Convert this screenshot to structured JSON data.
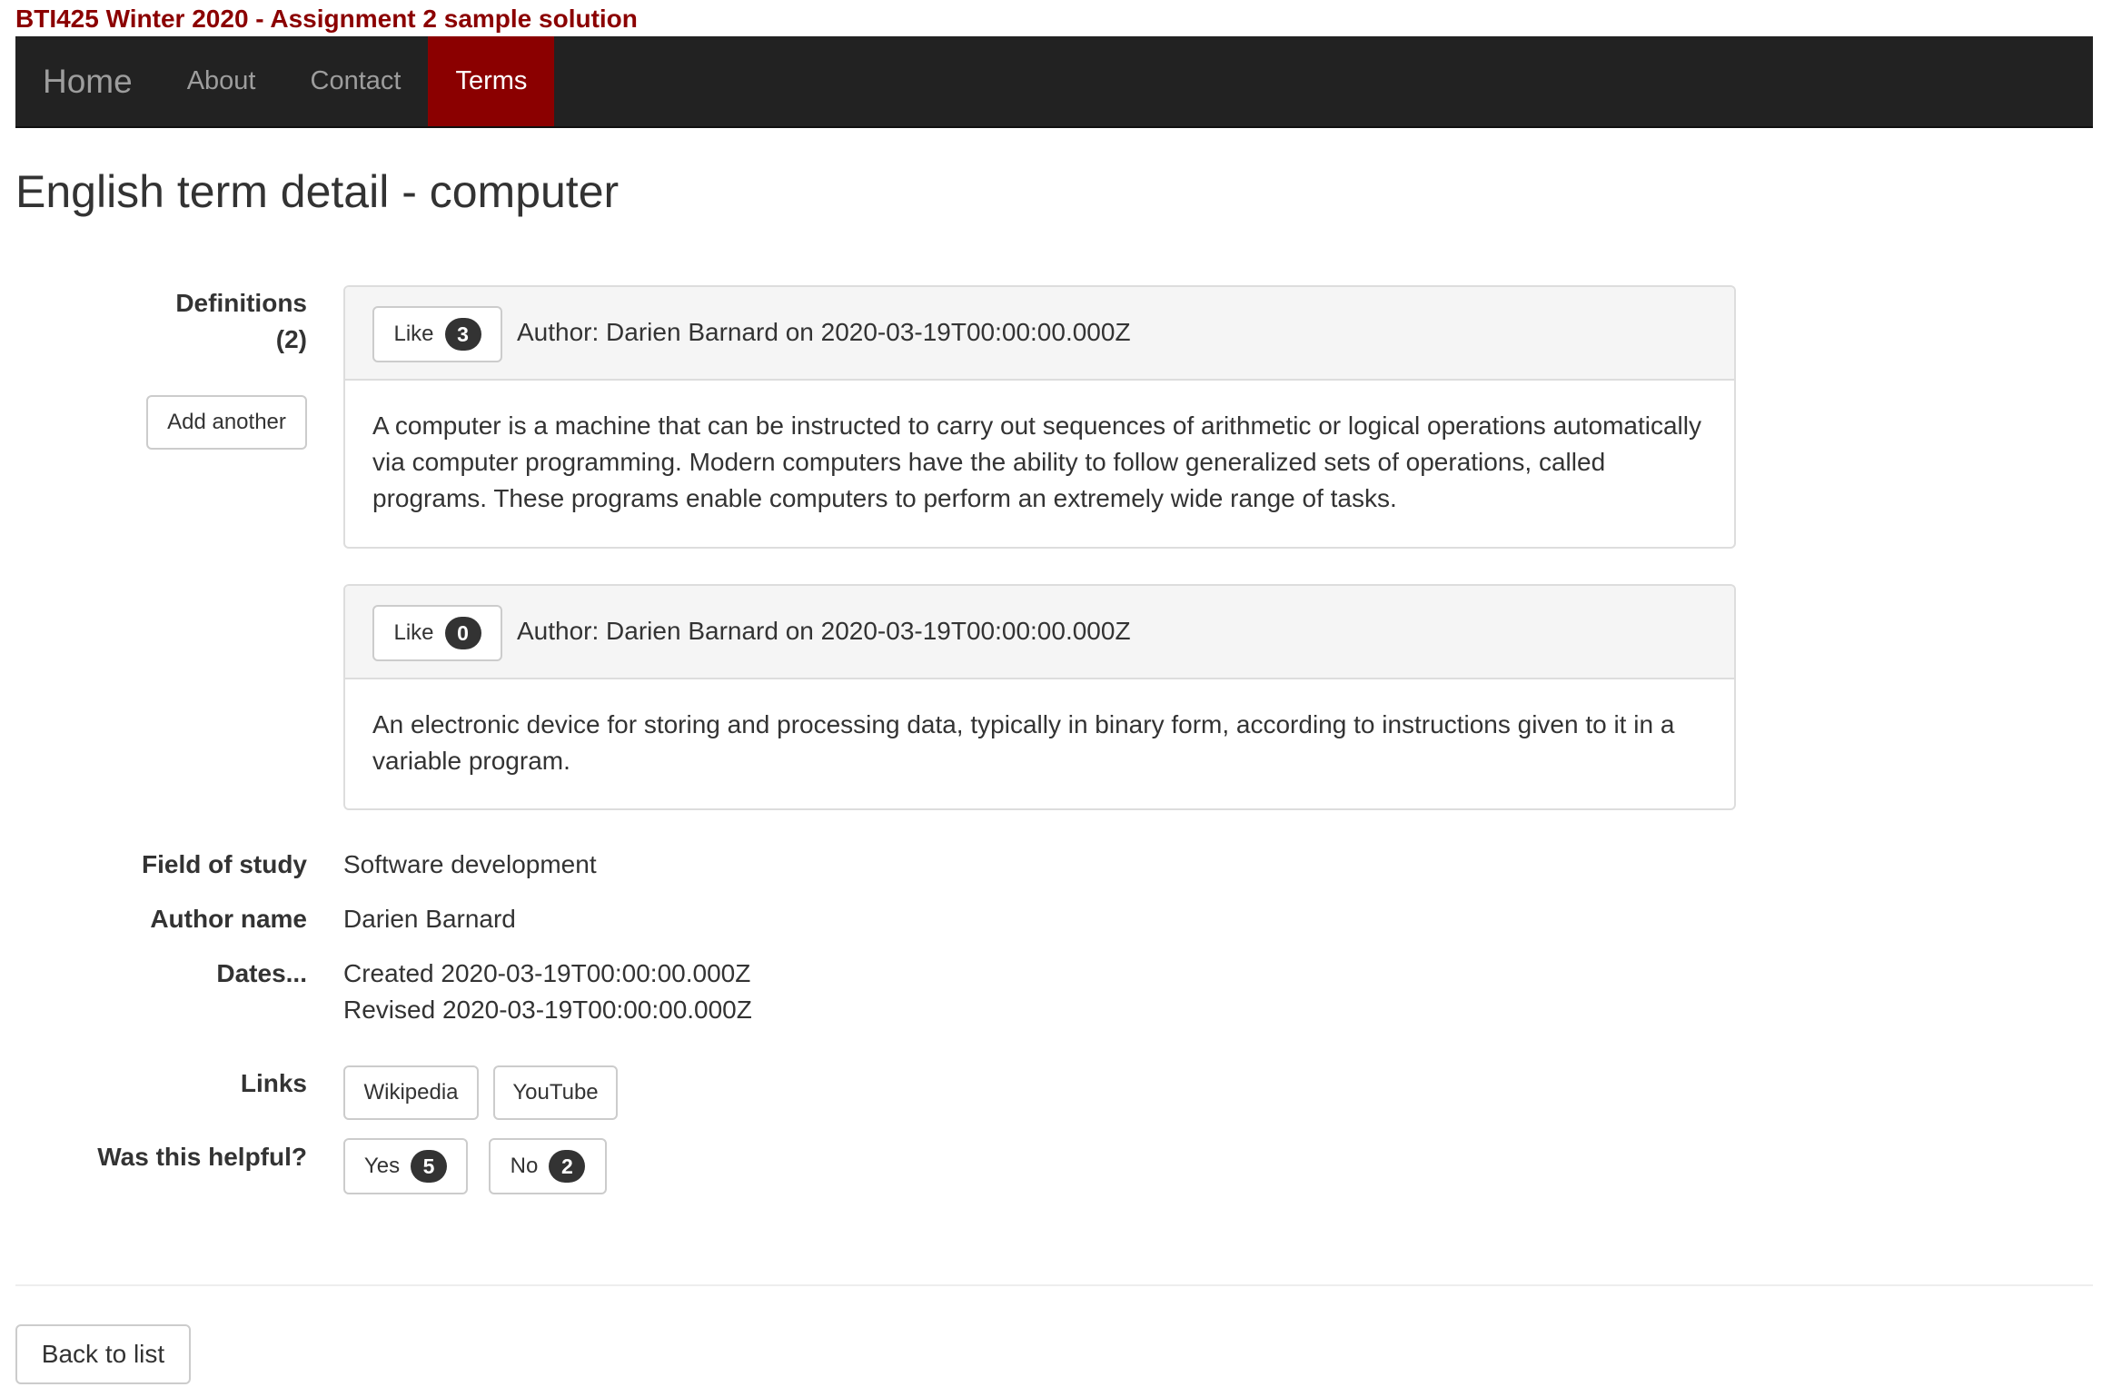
{
  "site_title": "BTI425 Winter 2020 - Assignment 2 sample solution",
  "nav": {
    "brand": "Home",
    "links": [
      "About",
      "Contact",
      "Terms"
    ],
    "active": "Terms"
  },
  "page_title": "English term detail - computer",
  "definitions": {
    "label": "Definitions",
    "count_label": "(2)",
    "add_button": "Add another",
    "items": [
      {
        "like_label": "Like",
        "likes": "3",
        "author": "Author: Darien Barnard on 2020-03-19T00:00:00.000Z",
        "text": "A computer is a machine that can be instructed to carry out sequences of arithmetic or logical operations automatically via computer programming. Modern computers have the ability to follow generalized sets of operations, called programs. These programs enable computers to perform an extremely wide range of tasks."
      },
      {
        "like_label": "Like",
        "likes": "0",
        "author": "Author: Darien Barnard on 2020-03-19T00:00:00.000Z",
        "text": "An electronic device for storing and processing data, typically in binary form, according to instructions given to it in a variable program."
      }
    ]
  },
  "field_of_study": {
    "label": "Field of study",
    "value": "Software development"
  },
  "author_name": {
    "label": "Author name",
    "value": "Darien Barnard"
  },
  "dates": {
    "label": "Dates...",
    "created": "Created 2020-03-19T00:00:00.000Z",
    "revised": "Revised 2020-03-19T00:00:00.000Z"
  },
  "links": {
    "label": "Links",
    "items": [
      "Wikipedia",
      "YouTube"
    ]
  },
  "helpful": {
    "label": "Was this helpful?",
    "yes_label": "Yes",
    "yes_count": "5",
    "no_label": "No",
    "no_count": "2"
  },
  "back_button": "Back to list",
  "colors": {
    "brand": "#8b0000",
    "navbar": "#222222",
    "badge": "#333333"
  }
}
